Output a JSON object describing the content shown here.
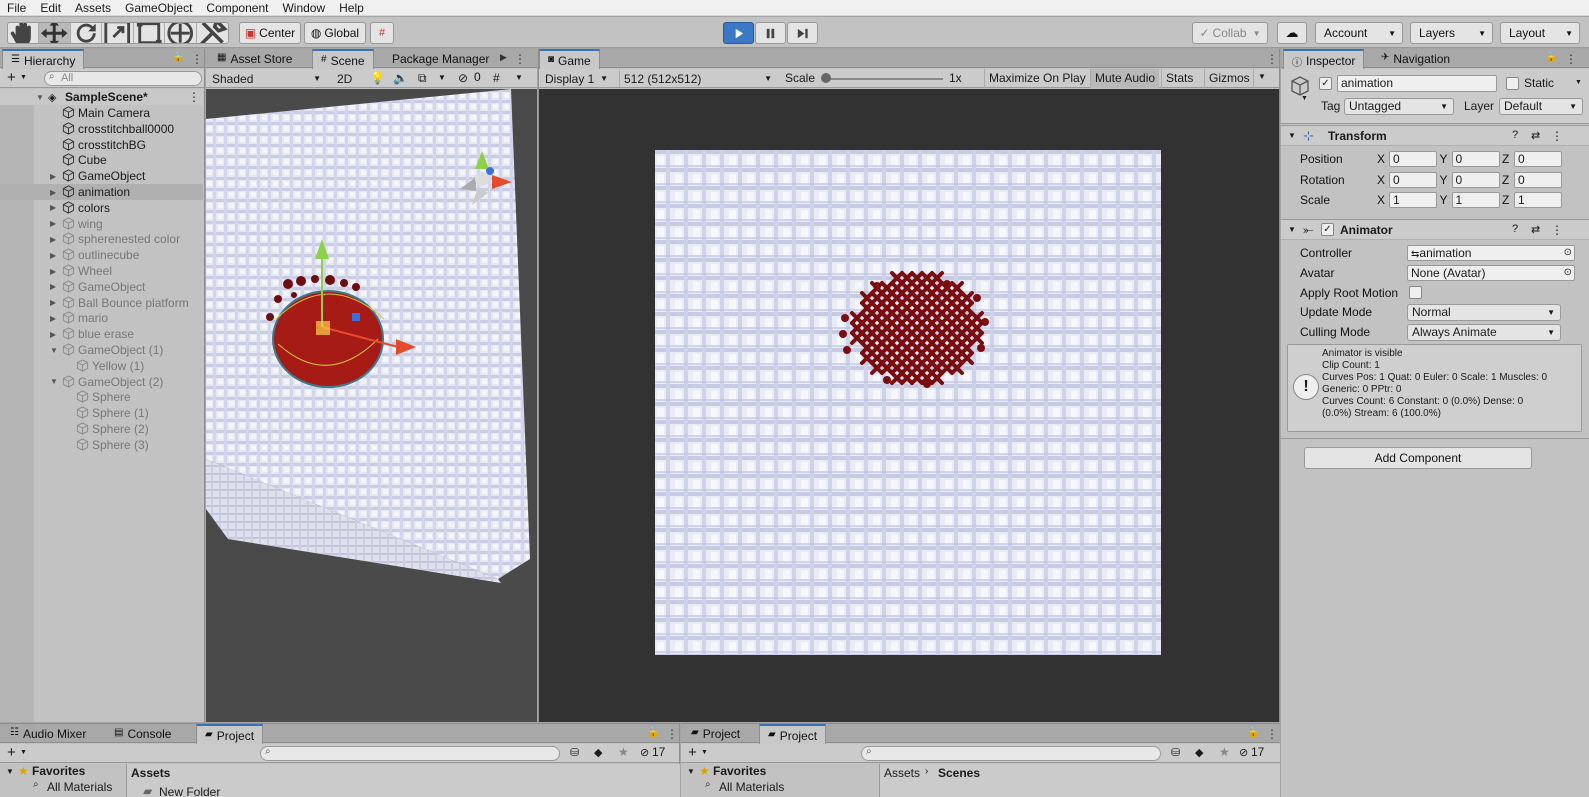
{
  "menu": [
    "File",
    "Edit",
    "Assets",
    "GameObject",
    "Component",
    "Window",
    "Help"
  ],
  "toolbar": {
    "center_label": "Center",
    "global_label": "Global",
    "collab_label": "Collab",
    "account_label": "Account",
    "layers_label": "Layers",
    "layout_label": "Layout",
    "tools": [
      "hand-tool-icon",
      "move-tool-icon",
      "rotate-tool-icon",
      "scale-tool-icon",
      "rect-tool-icon",
      "transform-tool-icon",
      "custom-tool-icon"
    ]
  },
  "hierarchy": {
    "tab": "Hierarchy",
    "search_placeholder": "All",
    "scene": "SampleScene*",
    "items": [
      {
        "label": "Main Camera",
        "depth": 1,
        "fold": false,
        "dim": false
      },
      {
        "label": "crosstitchball0000",
        "depth": 1,
        "fold": false,
        "dim": false
      },
      {
        "label": "crosstitchBG",
        "depth": 1,
        "fold": false,
        "dim": false
      },
      {
        "label": "Cube",
        "depth": 1,
        "fold": false,
        "dim": false
      },
      {
        "label": "GameObject",
        "depth": 1,
        "fold": "closed",
        "dim": false
      },
      {
        "label": "animation",
        "depth": 1,
        "fold": "closed",
        "dim": false,
        "selected": true
      },
      {
        "label": "colors",
        "depth": 1,
        "fold": "closed",
        "dim": false
      },
      {
        "label": "wing",
        "depth": 1,
        "fold": "closed",
        "dim": true
      },
      {
        "label": "spherenested color",
        "depth": 1,
        "fold": "closed",
        "dim": true
      },
      {
        "label": "outlinecube",
        "depth": 1,
        "fold": "closed",
        "dim": true
      },
      {
        "label": "Wheel",
        "depth": 1,
        "fold": "closed",
        "dim": true
      },
      {
        "label": "GameObject",
        "depth": 1,
        "fold": "closed",
        "dim": true
      },
      {
        "label": "Ball Bounce platform",
        "depth": 1,
        "fold": "closed",
        "dim": true
      },
      {
        "label": "mario",
        "depth": 1,
        "fold": "closed",
        "dim": true
      },
      {
        "label": "blue erase",
        "depth": 1,
        "fold": "closed",
        "dim": true
      },
      {
        "label": "GameObject (1)",
        "depth": 1,
        "fold": "open",
        "dim": true
      },
      {
        "label": "Yellow (1)",
        "depth": 2,
        "fold": false,
        "dim": true
      },
      {
        "label": "GameObject (2)",
        "depth": 1,
        "fold": "open",
        "dim": true
      },
      {
        "label": "Sphere",
        "depth": 2,
        "fold": false,
        "dim": true
      },
      {
        "label": "Sphere (1)",
        "depth": 2,
        "fold": false,
        "dim": true
      },
      {
        "label": "Sphere (2)",
        "depth": 2,
        "fold": false,
        "dim": true
      },
      {
        "label": "Sphere (3)",
        "depth": 2,
        "fold": false,
        "dim": true
      }
    ]
  },
  "scene": {
    "tabs": [
      "Asset Store",
      "Scene",
      "Package Manager"
    ],
    "shading": "Shaded",
    "mode_2d": "2D",
    "hidden_count": "0"
  },
  "game": {
    "tab": "Game",
    "display": "Display 1",
    "resolution": "512 (512x512)",
    "scale_label": "Scale",
    "scale_value": "1x",
    "maximize": "Maximize On Play",
    "mute": "Mute Audio",
    "stats": "Stats",
    "gizmos": "Gizmos"
  },
  "inspector": {
    "tabs": [
      "Inspector",
      "Navigation"
    ],
    "object_name": "animation",
    "static_label": "Static",
    "tag_label": "Tag",
    "tag_value": "Untagged",
    "layer_label": "Layer",
    "layer_value": "Default",
    "transform": {
      "title": "Transform",
      "rows": [
        {
          "label": "Position",
          "x": "0",
          "y": "0",
          "z": "0"
        },
        {
          "label": "Rotation",
          "x": "0",
          "y": "0",
          "z": "0"
        },
        {
          "label": "Scale",
          "x": "1",
          "y": "1",
          "z": "1"
        }
      ]
    },
    "animator": {
      "title": "Animator",
      "controller_label": "Controller",
      "controller_value": "animation",
      "avatar_label": "Avatar",
      "avatar_value": "None (Avatar)",
      "apply_root_label": "Apply Root Motion",
      "update_label": "Update Mode",
      "update_value": "Normal",
      "culling_label": "Culling Mode",
      "culling_value": "Always Animate",
      "info_lines": [
        "Animator is visible",
        "Clip Count: 1",
        "Curves Pos: 1 Quat: 0 Euler: 0 Scale: 1 Muscles: 0",
        "Generic: 0 PPtr: 0",
        "Curves Count: 6 Constant: 0 (0.0%) Dense: 0",
        "(0.0%) Stream: 6 (100.0%)"
      ]
    },
    "add_component": "Add Component"
  },
  "bottom_left": {
    "tabs": [
      "Audio Mixer",
      "Console",
      "Project"
    ],
    "favorites": "Favorites",
    "all_materials": "All Materials",
    "assets_header": "Assets",
    "new_folder": "New Folder",
    "hidden_count": "17"
  },
  "bottom_right": {
    "tabs": [
      "Project",
      "Project"
    ],
    "favorites": "Favorites",
    "all_materials": "All Materials",
    "breadcrumb_root": "Assets",
    "breadcrumb_current": "Scenes",
    "hidden_count": "17"
  },
  "colors": {
    "accent": "#3a72b0",
    "play_active": "#3b78c6",
    "stitch_red": "#7a0d10"
  }
}
